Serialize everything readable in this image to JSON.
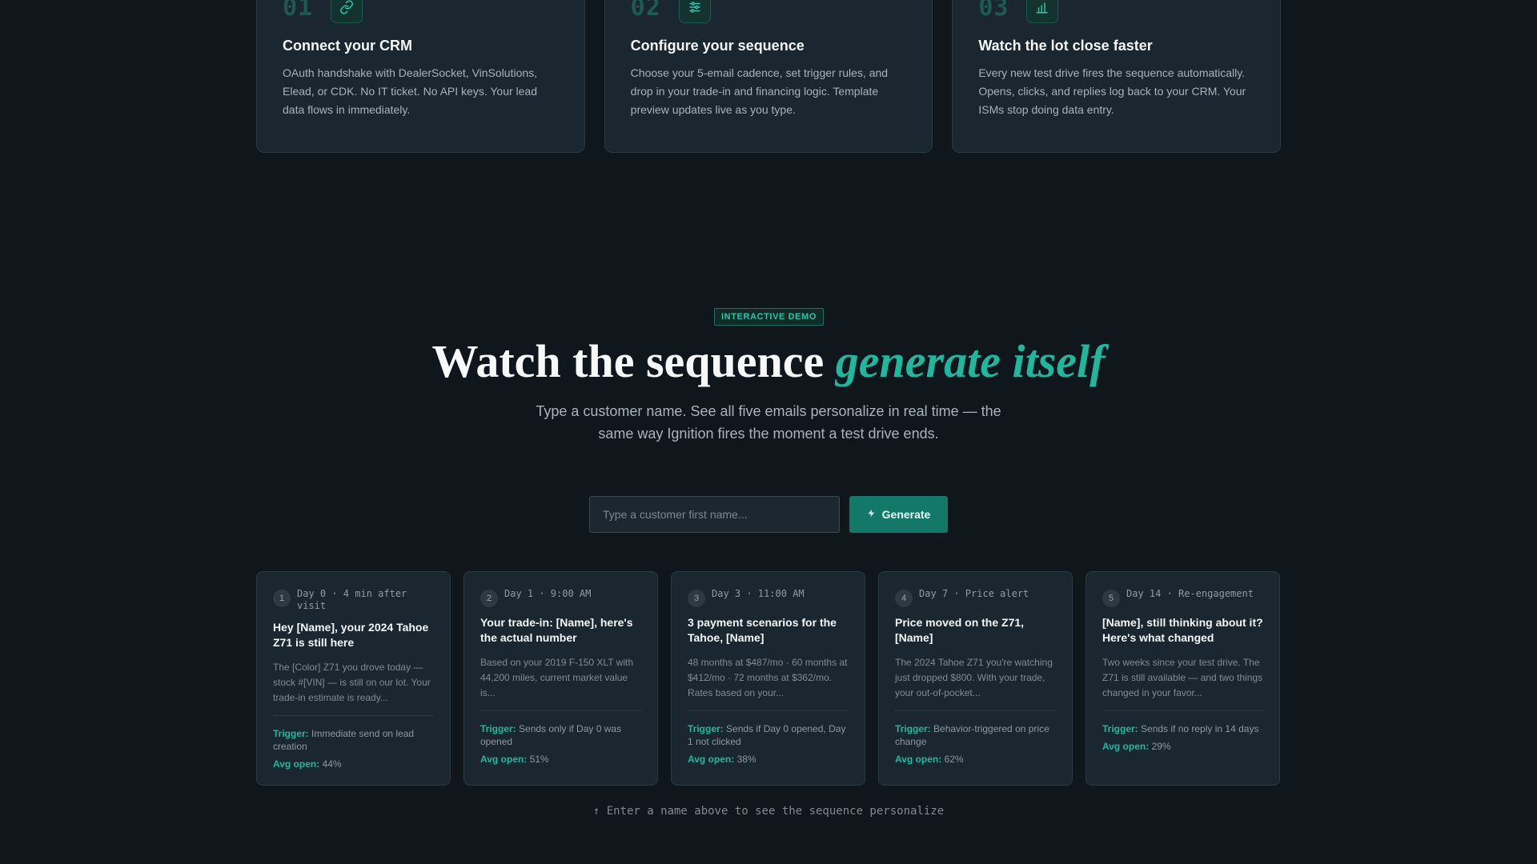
{
  "steps": [
    {
      "num": "01",
      "icon": "link-icon",
      "title": "Connect your CRM",
      "desc": "OAuth handshake with DealerSocket, VinSolutions, Elead, or CDK. No IT ticket. No API keys. Your lead data flows in immediately."
    },
    {
      "num": "02",
      "icon": "sliders-icon",
      "title": "Configure your sequence",
      "desc": "Choose your 5-email cadence, set trigger rules, and drop in your trade-in and financing logic. Template preview updates live as you type."
    },
    {
      "num": "03",
      "icon": "bar-chart-icon",
      "title": "Watch the lot close faster",
      "desc": "Every new test drive fires the sequence automatically. Opens, clicks, and replies log back to your CRM. Your ISMs stop doing data entry."
    }
  ],
  "demo": {
    "badge": "INTERACTIVE DEMO",
    "title_plain": "Watch the sequence ",
    "title_accent": "generate itself",
    "subtitle": "Type a customer name. See all five emails personalize in real time — the same way Ignition fires the moment a test drive ends.",
    "input_placeholder": "Type a customer first name...",
    "input_value": "",
    "button_label": "Generate",
    "hint": "↑ Enter a name above to see the sequence personalize"
  },
  "emails": [
    {
      "idx": "1",
      "when": "Day 0 · 4 min after visit",
      "subject": "Hey [Name], your 2024 Tahoe Z71 is still here",
      "preview": "The [Color] Z71 you drove today — stock #[VIN] — is still on our lot. Your trade-in estimate is ready...",
      "trigger_label": "Trigger:",
      "trigger": "Immediate send on lead creation",
      "open_label": "Avg open:",
      "open": "44%"
    },
    {
      "idx": "2",
      "when": "Day 1 · 9:00 AM",
      "subject": "Your trade-in: [Name], here's the actual number",
      "preview": "Based on your 2019 F-150 XLT with 44,200 miles, current market value is...",
      "trigger_label": "Trigger:",
      "trigger": "Sends only if Day 0 was opened",
      "open_label": "Avg open:",
      "open": "51%"
    },
    {
      "idx": "3",
      "when": "Day 3 · 11:00 AM",
      "subject": "3 payment scenarios for the Tahoe, [Name]",
      "preview": "48 months at $487/mo · 60 months at $412/mo · 72 months at $362/mo. Rates based on your...",
      "trigger_label": "Trigger:",
      "trigger": "Sends if Day 0 opened, Day 1 not clicked",
      "open_label": "Avg open:",
      "open": "38%"
    },
    {
      "idx": "4",
      "when": "Day 7 · Price alert",
      "subject": "Price moved on the Z71, [Name]",
      "preview": "The 2024 Tahoe Z71 you're watching just dropped $800. With your trade, your out-of-pocket...",
      "trigger_label": "Trigger:",
      "trigger": "Behavior-triggered on price change",
      "open_label": "Avg open:",
      "open": "62%"
    },
    {
      "idx": "5",
      "when": "Day 14 · Re-engagement",
      "subject": "[Name], still thinking about it? Here's what changed",
      "preview": "Two weeks since your test drive. The Z71 is still available — and two things changed in your favor...",
      "trigger_label": "Trigger:",
      "trigger": "Sends if no reply in 14 days",
      "open_label": "Avg open:",
      "open": "29%"
    }
  ]
}
